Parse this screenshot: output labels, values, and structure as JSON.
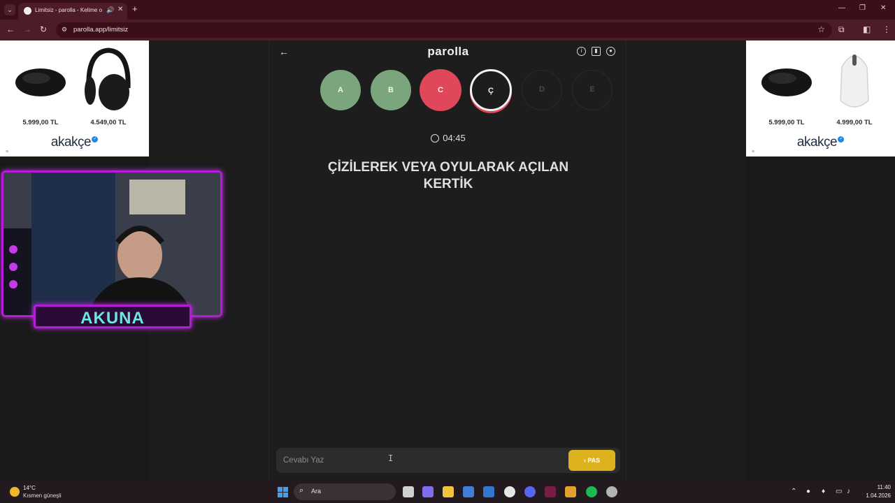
{
  "browser": {
    "tab_title": "Limitsiz - parolla - Kelime o",
    "url": "parolla.app/limitsiz"
  },
  "ads": {
    "left": {
      "products": [
        {
          "price": "5.999,00 TL",
          "icon": "mouse-black"
        },
        {
          "price": "4.549,00 TL",
          "icon": "headphones-black"
        }
      ],
      "brand": "akakçe"
    },
    "right": {
      "products": [
        {
          "price": "5.999,00 TL",
          "icon": "mouse-black"
        },
        {
          "price": "4.999,00 TL",
          "icon": "mouse-white"
        }
      ],
      "brand": "akakçe"
    }
  },
  "webcam": {
    "streamer_name": "AKUNA"
  },
  "game": {
    "title": "parolla",
    "letters": [
      {
        "label": "A",
        "state": "correct"
      },
      {
        "label": "B",
        "state": "correct"
      },
      {
        "label": "C",
        "state": "wrong"
      },
      {
        "label": "Ç",
        "state": "current"
      },
      {
        "label": "D",
        "state": "pending"
      },
      {
        "label": "E",
        "state": "pending"
      }
    ],
    "timer": "04:45",
    "question": "ÇİZİLEREK VEYA OYULARAK AÇILAN KERTİK",
    "answer_placeholder": "Cevabı Yaz",
    "pass_label": "PAS",
    "colors": {
      "correct": "#7ba57d",
      "wrong": "#e0475a",
      "current": "#1d1d1d",
      "pending": "#1d1d1d",
      "pass": "#dcb21e"
    }
  },
  "taskbar": {
    "temperature": "14°C",
    "weather": "Kısmen güneşli",
    "search_label": "Ara",
    "time": "11:40",
    "date": "1.04.2026"
  }
}
